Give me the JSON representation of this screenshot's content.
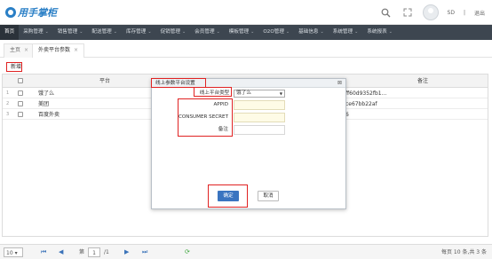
{
  "app": {
    "logo_text": "用手掌柜",
    "user_name": "SD",
    "separator": "|",
    "logout_label": "退出"
  },
  "nav": {
    "items": [
      {
        "label": "首页",
        "has_caret": false
      },
      {
        "label": "采购管理",
        "has_caret": true
      },
      {
        "label": "销售管理",
        "has_caret": true
      },
      {
        "label": "配送管理",
        "has_caret": true
      },
      {
        "label": "库存管理",
        "has_caret": true
      },
      {
        "label": "促销管理",
        "has_caret": true
      },
      {
        "label": "会员管理",
        "has_caret": true
      },
      {
        "label": "模板管理",
        "has_caret": true
      },
      {
        "label": "O2O管理",
        "has_caret": true
      },
      {
        "label": "基础信息",
        "has_caret": true
      },
      {
        "label": "系统管理",
        "has_caret": true
      },
      {
        "label": "系统报表",
        "has_caret": true
      }
    ],
    "caret": "⌄"
  },
  "tabs": [
    {
      "label": "主页",
      "close": "×"
    },
    {
      "label": "外卖平台参数",
      "close": "×"
    }
  ],
  "toolbar": {
    "new_label": "新增"
  },
  "grid": {
    "columns": [
      "平台",
      "备注"
    ],
    "rows": [
      {
        "num": "1",
        "platform": "饿了么",
        "code": "ff60d9352fb1..."
      },
      {
        "num": "2",
        "platform": "美团",
        "code": "ce67bb22af"
      },
      {
        "num": "3",
        "platform": "百度外卖",
        "code": "6"
      }
    ]
  },
  "pager": {
    "page_size": "10",
    "page_size_caret": "▾",
    "first": "⏮",
    "prev": "◀",
    "page_label": "第",
    "page_value": "1",
    "total_pages": "/1",
    "next": "▶",
    "last": "⏭",
    "refresh": "⟳",
    "summary": "每页 10 条,共 3 条"
  },
  "modal": {
    "title": "线上参数平台设置",
    "close": "⊠",
    "platform_label": "线上平台类型",
    "platform_value": "饿了么",
    "appid_label": "APPID",
    "secret_label": "CONSUMER SECRET",
    "remark_label": "备注",
    "ok_label": "确定",
    "cancel_label": "取消"
  },
  "colors": {
    "nav_bg": "#3d4650",
    "accent": "#3a74c0",
    "highlight": "#e02222",
    "input_bg": "#fefbe6"
  }
}
